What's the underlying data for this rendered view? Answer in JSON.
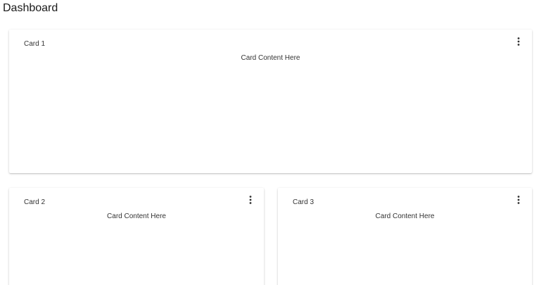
{
  "page": {
    "title": "Dashboard"
  },
  "cards": [
    {
      "title": "Card 1",
      "content": "Card Content Here",
      "menu_icon": "more-vert-icon"
    },
    {
      "title": "Card 2",
      "content": "Card Content Here",
      "menu_icon": "more-vert-icon"
    },
    {
      "title": "Card 3",
      "content": "Card Content Here",
      "menu_icon": "more-vert-icon"
    }
  ],
  "colors": {
    "background": "#ffffff",
    "card_background": "#ffffff",
    "text": "#333333"
  }
}
